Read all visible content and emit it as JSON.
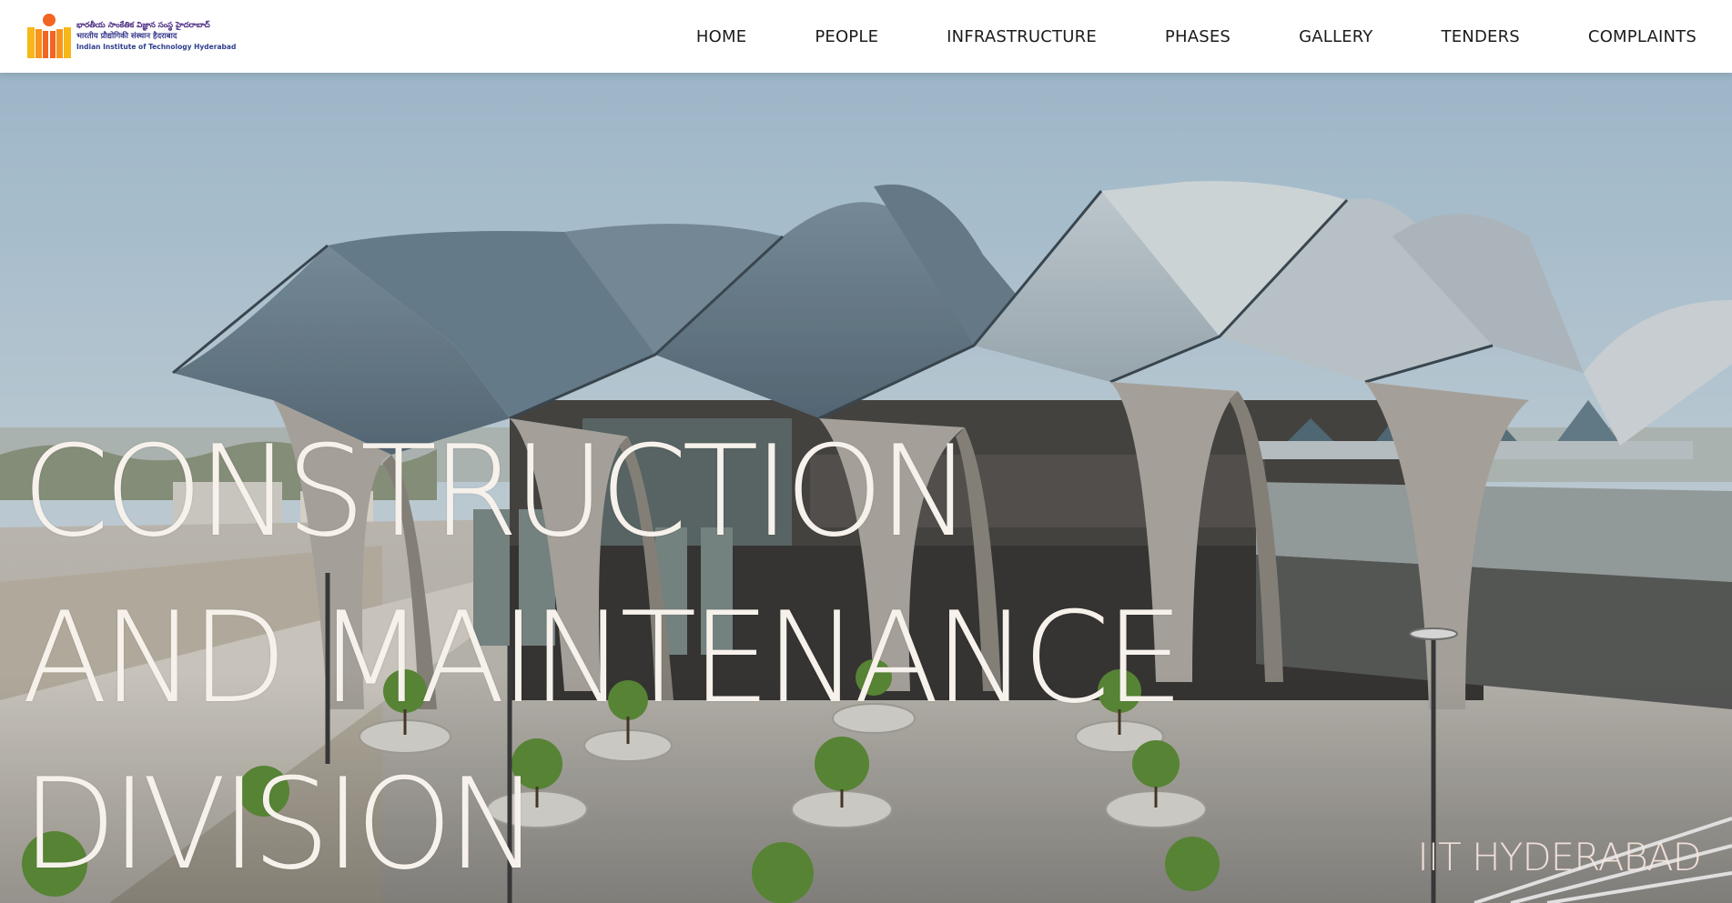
{
  "logo": {
    "telugu": "భారతీయ సాంకేతిక విజ్ఞాన సంస్థ హైదరాబాద్",
    "hindi": "भारतीय प्रौद्योगिकी संस्थान हैदराबाद",
    "english": "Indian Institute of Technology Hyderabad",
    "icon": "iith-logo-icon",
    "colors": {
      "orange": "#f26522",
      "yellow": "#f7b718",
      "purple": "#4b2c83"
    }
  },
  "nav": {
    "items": [
      {
        "label": "HOME"
      },
      {
        "label": "PEOPLE"
      },
      {
        "label": "INFRASTRUCTURE"
      },
      {
        "label": "PHASES"
      },
      {
        "label": "GALLERY"
      },
      {
        "label": "TENDERS"
      },
      {
        "label": "COMPLAINTS"
      }
    ]
  },
  "hero": {
    "title_lines": [
      "CONSTRUCTION",
      "AND MAINTENANCE",
      "DIVISION"
    ],
    "subtitle": "IIT HYDERABAD",
    "image": "campus-building-aerial-photo"
  },
  "colors": {
    "title": "#f7f1ec",
    "nav_text": "#1c1c1c",
    "sky": "#a9c4d6"
  }
}
